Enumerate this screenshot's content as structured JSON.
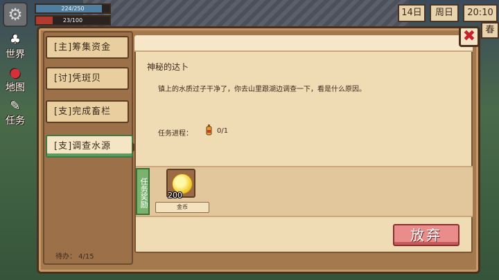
{
  "hud": {
    "health_text": "224/250",
    "health_fraction": 0.896,
    "energy_text": "23/100",
    "energy_fraction": 0.23,
    "date_day": "14日",
    "date_weekday": "周日",
    "time": "20:10",
    "season": "春"
  },
  "side_menu": [
    {
      "label": "世界",
      "icon": "globe-icon"
    },
    {
      "label": "地图",
      "icon": "map-pin-icon"
    },
    {
      "label": "任务",
      "icon": "quest-icon"
    }
  ],
  "quest_tabs": [
    {
      "label": "[主]筹集资金"
    },
    {
      "label": "[讨]凭斑贝"
    },
    {
      "label": "[支]完成畜栏"
    },
    {
      "label": "[支]调查水源",
      "active": true
    }
  ],
  "page_count": "待办： 4/15",
  "quest": {
    "title": "神秘的达卜",
    "description": "镇上的水质过子干净了，你去山里跟湖边调查一下，看是什么原因。",
    "progress_label": "任务进程：",
    "progress_value": "0/1"
  },
  "reward": {
    "tag": "任务奖励",
    "item_count": "200",
    "item_name": "金币"
  },
  "buttons": {
    "close": "✖",
    "abandon": "放弃"
  },
  "colors": {
    "abandon": "#e88c8c",
    "close_x": "#c8202a",
    "active_tab_accent": "#5b9b5e"
  }
}
